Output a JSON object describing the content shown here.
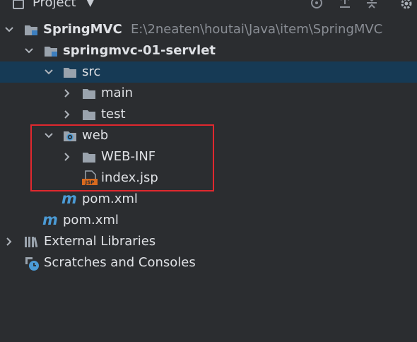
{
  "header": {
    "title": "Project",
    "caret": "▼"
  },
  "tree": {
    "root": {
      "name": "SpringMVC",
      "path": "E:\\2neaten\\houtai\\Java\\item\\SpringMVC"
    },
    "module": {
      "name": "springmvc-01-servlet"
    },
    "src": {
      "name": "src"
    },
    "main": {
      "name": "main"
    },
    "test": {
      "name": "test"
    },
    "web": {
      "name": "web"
    },
    "webinf": {
      "name": "WEB-INF"
    },
    "indexjsp": {
      "name": "index.jsp",
      "badge": "JSP"
    },
    "module_pom": {
      "name": "pom.xml",
      "glyph": "m"
    },
    "root_pom": {
      "name": "pom.xml",
      "glyph": "m"
    },
    "external_libraries": {
      "name": "External Libraries"
    },
    "scratches": {
      "name": "Scratches and Consoles"
    }
  },
  "colors": {
    "background": "#2b2d30",
    "selection": "#163a55",
    "highlight_border": "#e0282e",
    "maven_blue": "#4b9bd6",
    "jsp_orange": "#d86a1e"
  }
}
